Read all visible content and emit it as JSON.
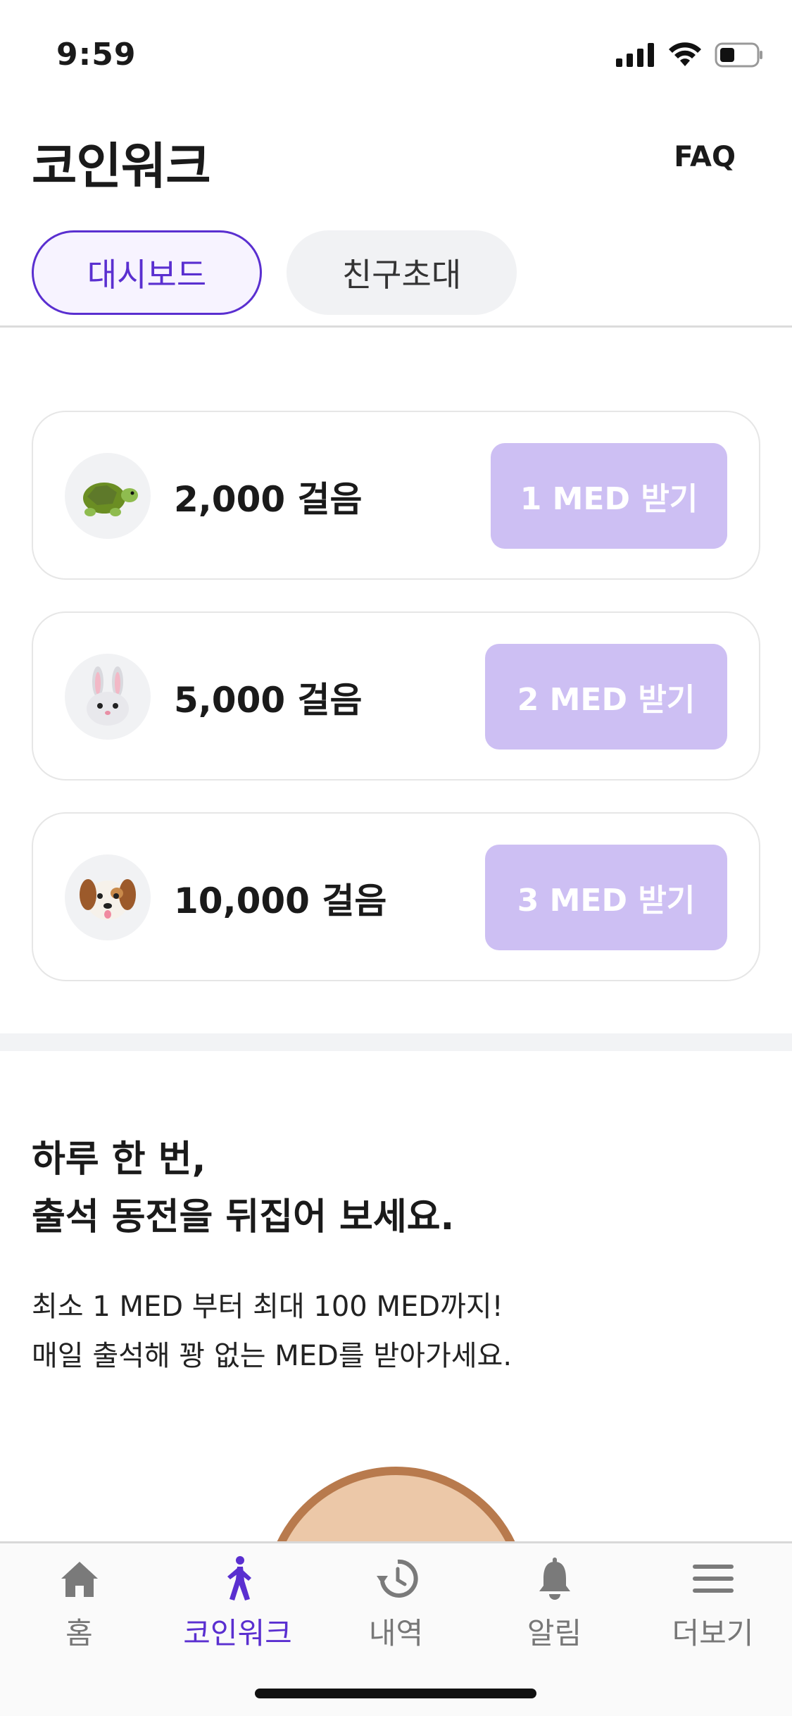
{
  "status_bar": {
    "time": "9:59"
  },
  "header": {
    "title": "코인워크",
    "faq_label": "FAQ"
  },
  "tabs": [
    {
      "label": "대시보드",
      "active": true
    },
    {
      "label": "친구초대",
      "active": false
    }
  ],
  "rewards": [
    {
      "icon": "turtle-icon",
      "steps_label": "2,000 걸음",
      "button_label": "1 MED 받기"
    },
    {
      "icon": "rabbit-icon",
      "steps_label": "5,000 걸음",
      "button_label": "2 MED 받기"
    },
    {
      "icon": "dog-icon",
      "steps_label": "10,000 걸음",
      "button_label": "3 MED 받기"
    }
  ],
  "attendance": {
    "title_line1": "하루 한 번,",
    "title_line2": "출석 동전을 뒤집어 보세요.",
    "desc_line1": "최소 1 MED 부터 최대 100 MED까지!",
    "desc_line2": "매일 출석해 꽝 없는 MED를 받아가세요."
  },
  "nav": [
    {
      "label": "홈",
      "icon": "home-icon",
      "active": false
    },
    {
      "label": "코인워크",
      "icon": "walking-icon",
      "active": true
    },
    {
      "label": "내역",
      "icon": "history-icon",
      "active": false
    },
    {
      "label": "알림",
      "icon": "bell-icon",
      "active": false
    },
    {
      "label": "더보기",
      "icon": "menu-icon",
      "active": false
    }
  ],
  "colors": {
    "accent": "#5a2fd0",
    "button_disabled": "#cdbff3",
    "coin_fill": "#ecc8a8",
    "coin_border": "#b87a4d"
  }
}
